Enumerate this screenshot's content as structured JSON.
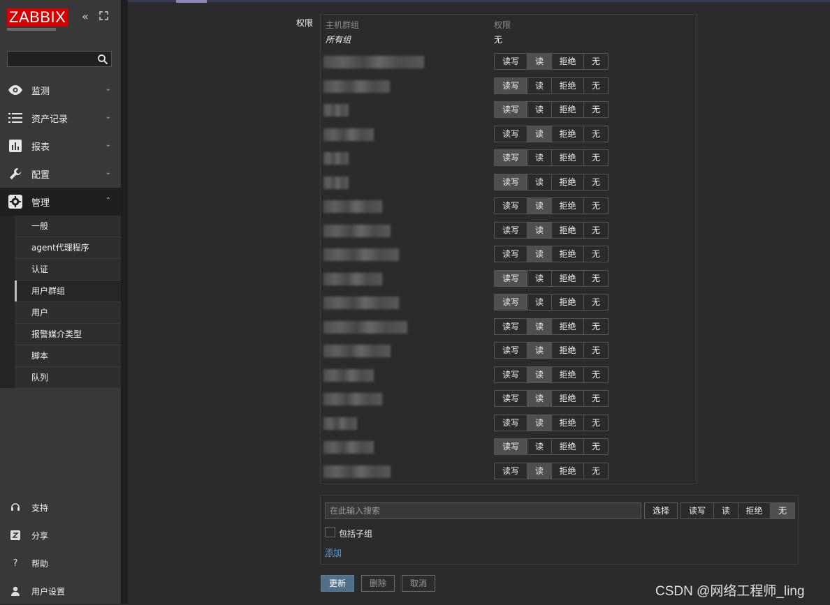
{
  "sidebar": {
    "logo": "ZABBIX",
    "menu": [
      {
        "label": "监测",
        "icon": "eye-icon"
      },
      {
        "label": "资产记录",
        "icon": "list-icon"
      },
      {
        "label": "报表",
        "icon": "bar-chart-icon"
      },
      {
        "label": "配置",
        "icon": "wrench-icon"
      },
      {
        "label": "管理",
        "icon": "gear-icon"
      }
    ],
    "submenu": [
      "一般",
      "agent代理程序",
      "认证",
      "用户群组",
      "用户",
      "报警媒介类型",
      "脚本",
      "队列"
    ],
    "submenu_selected": "用户群组",
    "bottom": [
      {
        "label": "支持",
        "icon": "headset-icon"
      },
      {
        "label": "分享",
        "icon": "share-icon"
      },
      {
        "label": "帮助",
        "icon": "help-icon"
      },
      {
        "label": "用户设置",
        "icon": "user-icon"
      }
    ]
  },
  "permissions": {
    "label": "权限",
    "col_host_group": "主机群组",
    "col_permission": "权限",
    "all_groups_label": "所有组",
    "all_groups_value": "无",
    "options": {
      "read_write": "读写",
      "read": "读",
      "deny": "拒绝",
      "none": "无"
    },
    "rows": [
      {
        "selected": "read"
      },
      {
        "selected": "read_write"
      },
      {
        "selected": "read_write"
      },
      {
        "selected": "read"
      },
      {
        "selected": "read_write"
      },
      {
        "selected": "read_write"
      },
      {
        "selected": "read"
      },
      {
        "selected": "read"
      },
      {
        "selected": "read"
      },
      {
        "selected": "read_write"
      },
      {
        "selected": "read_write"
      },
      {
        "selected": "read"
      },
      {
        "selected": "read"
      },
      {
        "selected": "read"
      },
      {
        "selected": "read"
      },
      {
        "selected": "read"
      },
      {
        "selected": "read_write"
      },
      {
        "selected": "read"
      }
    ]
  },
  "add_panel": {
    "search_placeholder": "在此输入搜索",
    "select_button": "选择",
    "selected": "none",
    "include_subgroups": "包括子组",
    "add_link": "添加"
  },
  "actions": {
    "update": "更新",
    "delete": "删除",
    "cancel": "取消"
  },
  "watermark": "CSDN @网络工程师_ling"
}
